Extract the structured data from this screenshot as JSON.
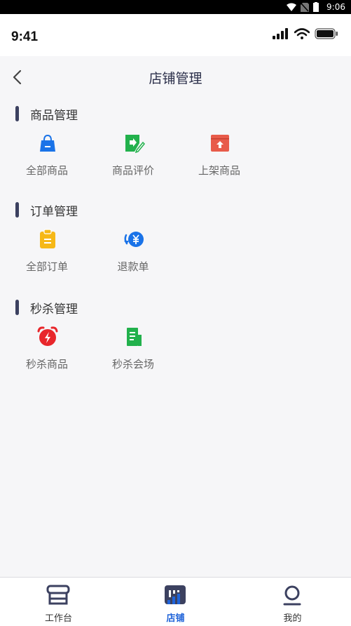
{
  "system_status": {
    "time": "9:06"
  },
  "ios_status": {
    "time": "9:41"
  },
  "header": {
    "title": "店铺管理"
  },
  "sections": [
    {
      "title": "商品管理",
      "items": [
        {
          "label": "全部商品",
          "icon": "shopping-bag-icon",
          "color": "#1a73e8"
        },
        {
          "label": "商品评价",
          "icon": "review-tag-icon",
          "color": "#22b14c"
        },
        {
          "label": "上架商品",
          "icon": "upload-box-icon",
          "color": "#e85b4a"
        }
      ]
    },
    {
      "title": "订单管理",
      "items": [
        {
          "label": "全部订单",
          "icon": "clipboard-icon",
          "color": "#f6b817"
        },
        {
          "label": "退款单",
          "icon": "refund-yen-icon",
          "color": "#1a73e8"
        }
      ]
    },
    {
      "title": "秒杀管理",
      "items": [
        {
          "label": "秒杀商品",
          "icon": "alarm-clock-icon",
          "color": "#e8262b"
        },
        {
          "label": "秒杀会场",
          "icon": "venue-document-icon",
          "color": "#22b14c"
        }
      ]
    }
  ],
  "tabbar": [
    {
      "label": "工作台",
      "icon": "storefront-icon",
      "active": false
    },
    {
      "label": "店铺",
      "icon": "shop-chart-icon",
      "active": true
    },
    {
      "label": "我的",
      "icon": "profile-icon",
      "active": false
    }
  ],
  "colors": {
    "accent": "#1f63d9",
    "section_bar": "#3c4160"
  }
}
